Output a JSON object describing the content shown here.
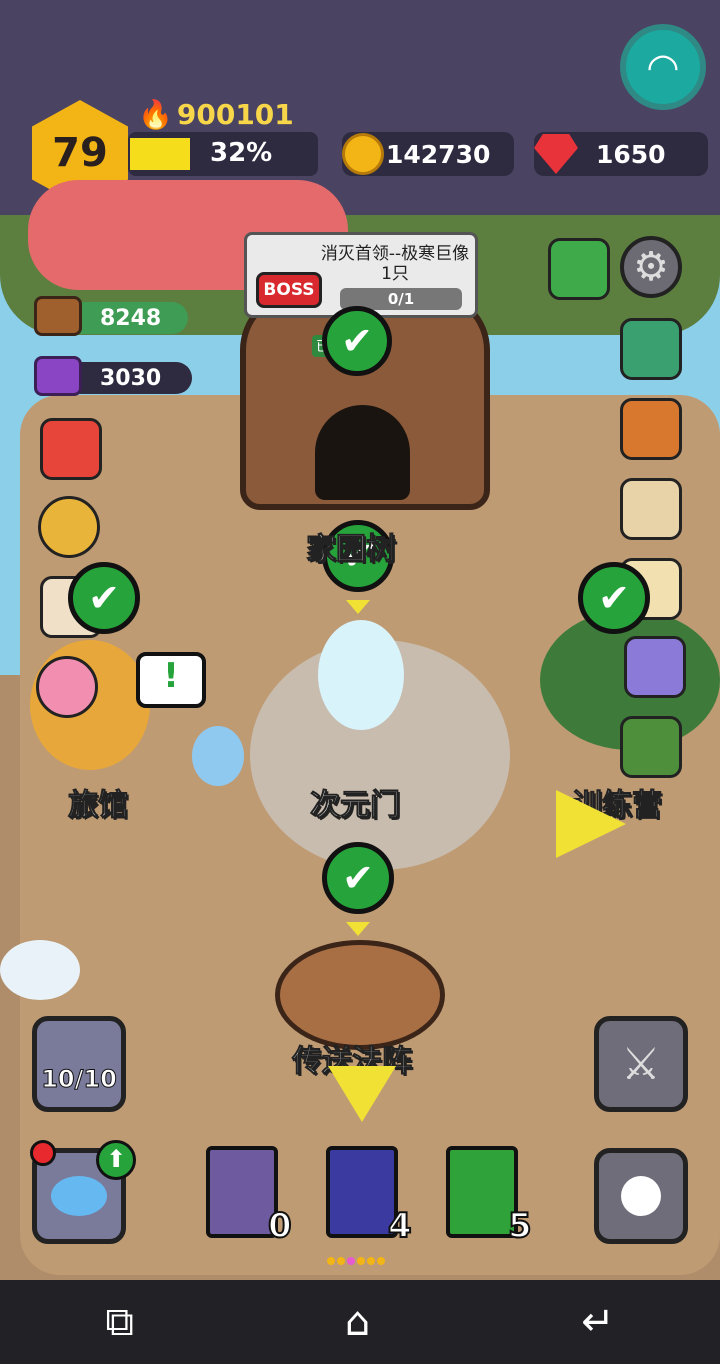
{
  "player": {
    "level": "79",
    "power": "900101",
    "xp_percent": "32%",
    "xp_fraction": 0.32
  },
  "resources": {
    "gold": "142730",
    "rubies": "1650",
    "wood": "8248",
    "crystal": "3030"
  },
  "quest": {
    "title": "消灭首领--极寒巨像1只",
    "boss_tag": "BOSS",
    "progress": "0/1",
    "refreshed": "已刷新"
  },
  "map_labels": {
    "tree": "家园树",
    "inn": "旅馆",
    "portal": "次元门",
    "camp": "训练营",
    "teleport": "传送法阵"
  },
  "bottom": {
    "slime_count": "10/10",
    "book_lightning": "0",
    "book_wing": "4",
    "book_heal": "5"
  },
  "icons": [
    "wifi-icon",
    "gear-icon",
    "mail-icon",
    "chest-icon",
    "map-icon",
    "scroll-icon",
    "skull-badge-icon",
    "shop-icon",
    "medal-icon",
    "calendar-icon",
    "tent-icon"
  ],
  "colors": {
    "accent": "#f3b515",
    "ruby": "#e8333a",
    "check": "#27a33c",
    "redaction": "#e46a6c"
  }
}
